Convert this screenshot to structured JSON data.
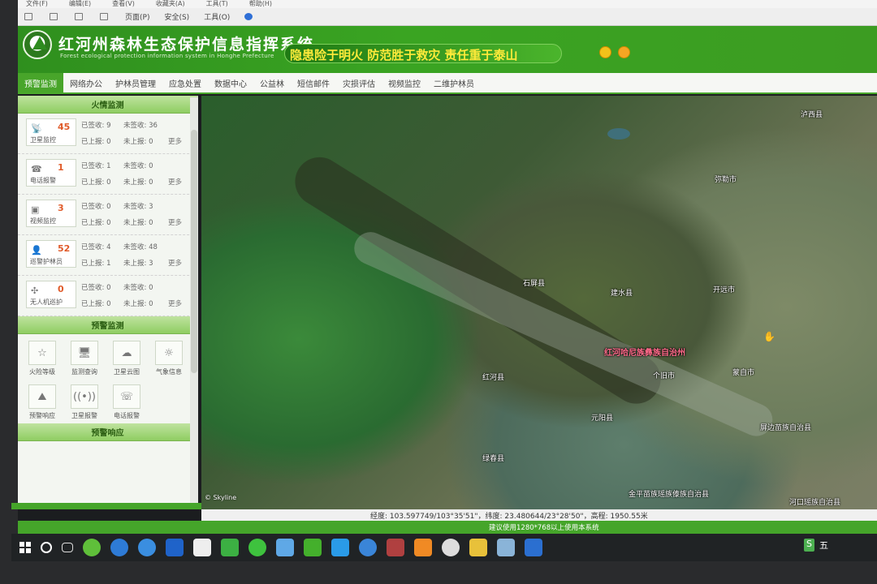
{
  "browser": {
    "menu": [
      "文件(F)",
      "编辑(E)",
      "查看(V)",
      "收藏夹(A)",
      "工具(T)",
      "帮助(H)"
    ],
    "toolbar": [
      "页面(P)",
      "安全(S)",
      "工具(O)"
    ]
  },
  "header": {
    "title": "红河州森林生态保护信息指挥系统",
    "subtitle": "Forest ecological protection information system in Honghe Prefecture",
    "slogan": "隐患险于明火 防范胜于救灾 责任重于泰山"
  },
  "nav": {
    "tabs": [
      "预警监测",
      "网络办公",
      "护林员管理",
      "应急处置",
      "数据中心",
      "公益林",
      "短信邮件",
      "灾损评估",
      "视频监控",
      "二维护林员"
    ]
  },
  "sidebar": {
    "fire_section": "火情监测",
    "alerts": [
      {
        "icon": "satellite-icon",
        "glyph": "📡",
        "count": "45",
        "name": "卫星监控",
        "signed": "已签收: 9",
        "unsigned": "未签收: 36",
        "reported": "已上报: 0",
        "unreported": "未上报: 0",
        "more": "更多"
      },
      {
        "icon": "phone-icon",
        "glyph": "☎",
        "count": "1",
        "name": "电话报警",
        "signed": "已签收: 1",
        "unsigned": "未签收: 0",
        "reported": "已上报: 0",
        "unreported": "未上报: 0",
        "more": "更多"
      },
      {
        "icon": "video-icon",
        "glyph": "▣",
        "count": "3",
        "name": "视频监控",
        "signed": "已签收: 0",
        "unsigned": "未签收: 3",
        "reported": "已上报: 0",
        "unreported": "未上报: 0",
        "more": "更多"
      },
      {
        "icon": "ranger-icon",
        "glyph": "👤",
        "count": "52",
        "name": "巡警护林员",
        "signed": "已签收: 4",
        "unsigned": "未签收: 48",
        "reported": "已上报: 1",
        "unreported": "未上报: 3",
        "more": "更多"
      },
      {
        "icon": "drone-icon",
        "glyph": "✣",
        "count": "0",
        "name": "无人机巡护",
        "signed": "已签收: 0",
        "unsigned": "未签收: 0",
        "reported": "已上报: 0",
        "unreported": "未上报: 0",
        "more": "更多"
      }
    ],
    "warning_section": "预警监测",
    "tools": [
      {
        "icon": "star-icon",
        "glyph": "☆",
        "label": "火险等级"
      },
      {
        "icon": "monitor-icon",
        "glyph": "🖥",
        "label": "监测查询"
      },
      {
        "icon": "cloud-icon",
        "glyph": "☁",
        "label": "卫星云图"
      },
      {
        "icon": "sun-icon",
        "glyph": "☼",
        "label": "气象信息"
      },
      {
        "icon": "alarm-icon",
        "glyph": "⛰",
        "label": "预警响应"
      },
      {
        "icon": "signal-icon",
        "glyph": "((•))",
        "label": "卫星报警"
      },
      {
        "icon": "telephone-icon",
        "glyph": "☏",
        "label": "电话报警"
      }
    ],
    "response_section": "预警响应"
  },
  "map": {
    "places": [
      {
        "name": "泸西县"
      },
      {
        "name": "弥勒市"
      },
      {
        "name": "石屏县"
      },
      {
        "name": "建水县"
      },
      {
        "name": "开远市"
      },
      {
        "name": "红河哈尼族彝族自治州"
      },
      {
        "name": "个旧市"
      },
      {
        "name": "蒙自市"
      },
      {
        "name": "红河县"
      },
      {
        "name": "元阳县"
      },
      {
        "name": "屏边苗族自治县"
      },
      {
        "name": "绿春县"
      },
      {
        "name": "金平苗族瑶族傣族自治县"
      },
      {
        "name": "河口瑶族自治县"
      }
    ],
    "brand": "© Skyline"
  },
  "status": {
    "coords": "经度: 103.597749/103°35'51\"，纬度: 23.480644/23°28'50\"，高程: 1950.55米",
    "footer": "建议使用1280*768以上使用本系统"
  },
  "taskbar": {
    "ime": "五"
  }
}
